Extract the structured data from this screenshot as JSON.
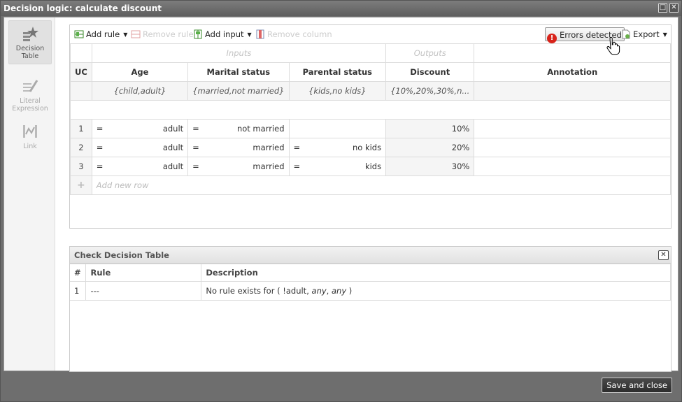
{
  "window": {
    "title": "Decision logic: calculate discount"
  },
  "sidebar": {
    "items": [
      {
        "label": "Decision Table",
        "icon": "decision-table-icon",
        "active": true
      },
      {
        "label": "Literal Expression",
        "icon": "literal-expression-icon",
        "active": false
      },
      {
        "label": "Link",
        "icon": "link-icon",
        "active": false
      }
    ]
  },
  "toolbar": {
    "add_rule": "Add rule",
    "remove_rule": "Remove rule",
    "add_input": "Add input",
    "remove_column": "Remove column",
    "errors": "Errors detected",
    "export": "Export"
  },
  "table": {
    "group_inputs": "Inputs",
    "group_outputs": "Outputs",
    "headers": {
      "uc": "UC",
      "age": "Age",
      "marital": "Marital status",
      "parental": "Parental status",
      "discount": "Discount",
      "annotation": "Annotation"
    },
    "types": {
      "age": "{child,adult}",
      "marital": "{married,not married}",
      "parental": "{kids,no kids}",
      "discount": "{10%,20%,30%,n..."
    },
    "rows": [
      {
        "n": "1",
        "age_op": "=",
        "age": "adult",
        "marital_op": "=",
        "marital": "not married",
        "parental_op": "",
        "parental": "",
        "discount": "10%"
      },
      {
        "n": "2",
        "age_op": "=",
        "age": "adult",
        "marital_op": "=",
        "marital": "married",
        "parental_op": "=",
        "parental": "no kids",
        "discount": "20%"
      },
      {
        "n": "3",
        "age_op": "=",
        "age": "adult",
        "marital_op": "=",
        "marital": "married",
        "parental_op": "=",
        "parental": "kids",
        "discount": "30%"
      }
    ],
    "add_row_icon": "+",
    "add_row": "Add new row"
  },
  "check": {
    "title": "Check Decision Table",
    "col_num": "#",
    "col_rule": "Rule",
    "col_desc": "Description",
    "rows": [
      {
        "n": "1",
        "rule": "---",
        "desc_prefix": "No rule exists for ( !adult, ",
        "desc_any1": "any",
        "desc_comma": ", ",
        "desc_any2": "any",
        "desc_suffix": " )"
      }
    ]
  },
  "footer": {
    "save_close": "Save and close"
  },
  "colors": {
    "error": "#d8231a",
    "titlebar": "#6e6e6e"
  }
}
